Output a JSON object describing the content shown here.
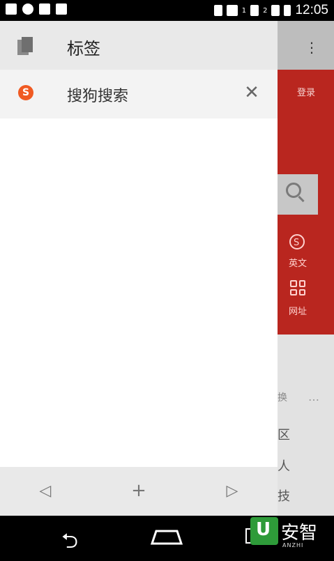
{
  "status_bar": {
    "time": "12:05",
    "sim1": "1",
    "sim2": "2"
  },
  "drawer": {
    "title": "标签",
    "tabs": [
      {
        "title": "搜狗搜索",
        "favicon_letter": "S"
      }
    ],
    "footer": {
      "back_icon": "◁",
      "add_icon": "+",
      "forward_icon": "▷"
    }
  },
  "background_page": {
    "more_icon": "⋮",
    "login": "登录",
    "english": "英文",
    "web": "网址",
    "partial_text_1": "换",
    "partial_text_2": "区",
    "partial_text_3": "人",
    "partial_text_4": "技"
  },
  "watermark": {
    "text": "安智",
    "sub": "ANZHI"
  },
  "colors": {
    "accent_red": "#b9261f",
    "sogou_orange": "#f05a22"
  }
}
